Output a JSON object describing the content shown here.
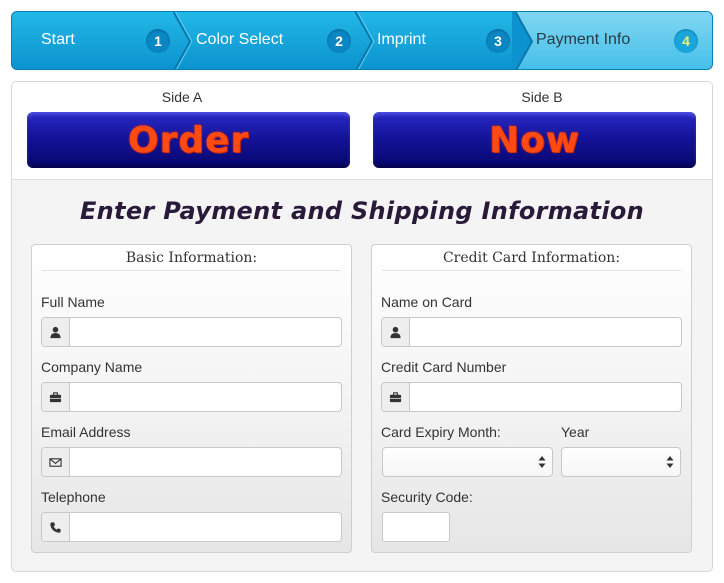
{
  "steps": [
    {
      "label": "Start",
      "number": "1"
    },
    {
      "label": "Color Select",
      "number": "2"
    },
    {
      "label": "Imprint",
      "number": "3"
    },
    {
      "label": "Payment Info",
      "number": "4",
      "active": true
    }
  ],
  "preview": {
    "side_a": {
      "label": "Side A",
      "text": "Order"
    },
    "side_b": {
      "label": "Side B",
      "text": "Now"
    },
    "band_color": "#14149a",
    "text_color": "#ff4a12"
  },
  "form": {
    "title": "Enter Payment and Shipping Information",
    "basic": {
      "legend": "Basic Information:",
      "full_name": {
        "label": "Full Name",
        "icon": "user-icon",
        "value": ""
      },
      "company_name": {
        "label": "Company Name",
        "icon": "briefcase-icon",
        "value": ""
      },
      "email": {
        "label": "Email Address",
        "icon": "envelope-icon",
        "value": ""
      },
      "telephone": {
        "label": "Telephone",
        "icon": "phone-icon",
        "value": ""
      }
    },
    "card": {
      "legend": "Credit Card Information:",
      "name_on_card": {
        "label": "Name on Card",
        "icon": "user-icon",
        "value": ""
      },
      "card_number": {
        "label": "Credit Card Number",
        "icon": "briefcase-icon",
        "value": ""
      },
      "expiry_month": {
        "label": "Card Expiry Month:",
        "value": ""
      },
      "year": {
        "label": "Year",
        "value": ""
      },
      "security_code": {
        "label": "Security Code:",
        "value": ""
      }
    }
  },
  "colors": {
    "step_bar": "#0c93cf",
    "step_active": "#45bfe9",
    "panel_bg": "#f4f4f4"
  }
}
